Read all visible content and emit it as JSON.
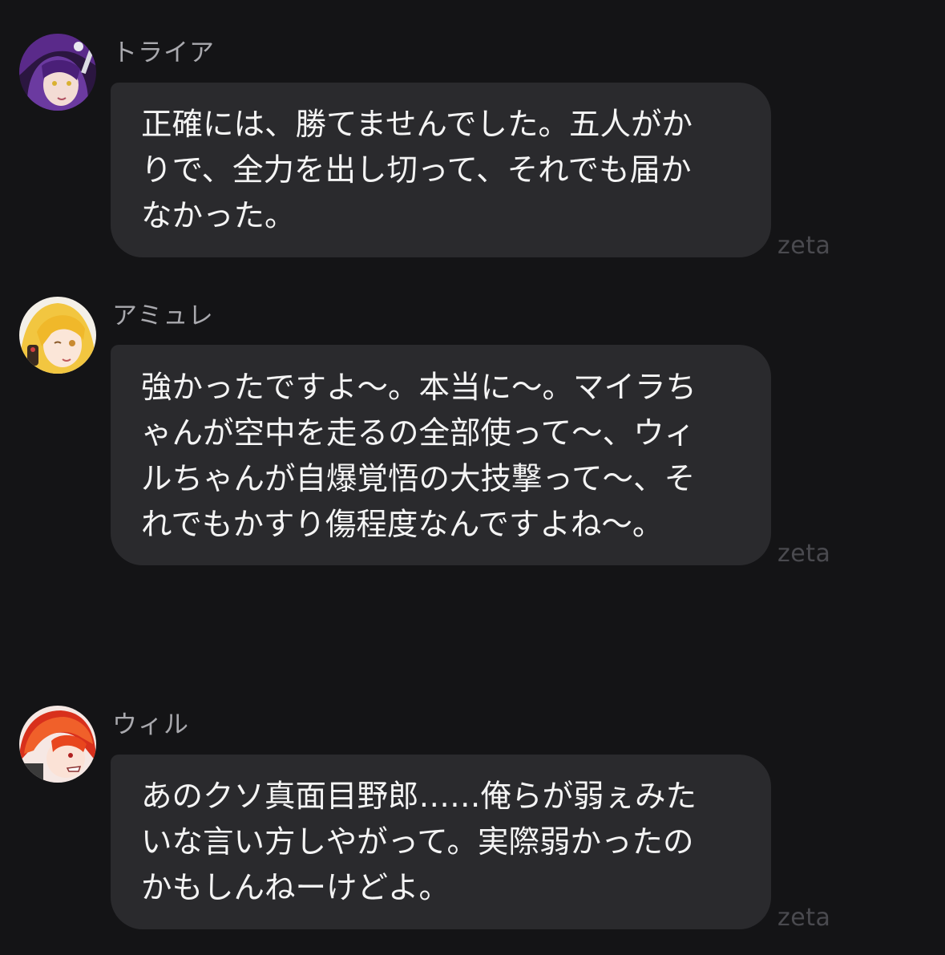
{
  "messages": [
    {
      "sender": "トライア",
      "avatar_icon": "purple-haired-character-avatar",
      "text": "正確には、勝てませんでした。五人がか\nりで、全力を出し切って、それでも届か\nなかった。",
      "tag": "zeta"
    },
    {
      "sender": "アミュレ",
      "avatar_icon": "blonde-character-avatar",
      "text": "強かったですよ〜。本当に〜。マイラち\nゃんが空中を走るの全部使って〜、ウィ\nルちゃんが自爆覚悟の大技撃って〜、そ\nれでもかすり傷程度なんですよね〜。",
      "tag": "zeta"
    },
    {
      "sender": "ウィル",
      "avatar_icon": "red-haired-character-avatar",
      "text": "あのクソ真面目野郎……俺らが弱ぇみた\nいな言い方しやがって。実際弱かったの\nかもしんねーけどよ。",
      "tag": "zeta"
    }
  ],
  "colors": {
    "background": "#141416",
    "bubble": "#2a2a2d",
    "text": "#f4f4f4",
    "name": "#a9a9ae",
    "tag": "#4a4a4f"
  }
}
